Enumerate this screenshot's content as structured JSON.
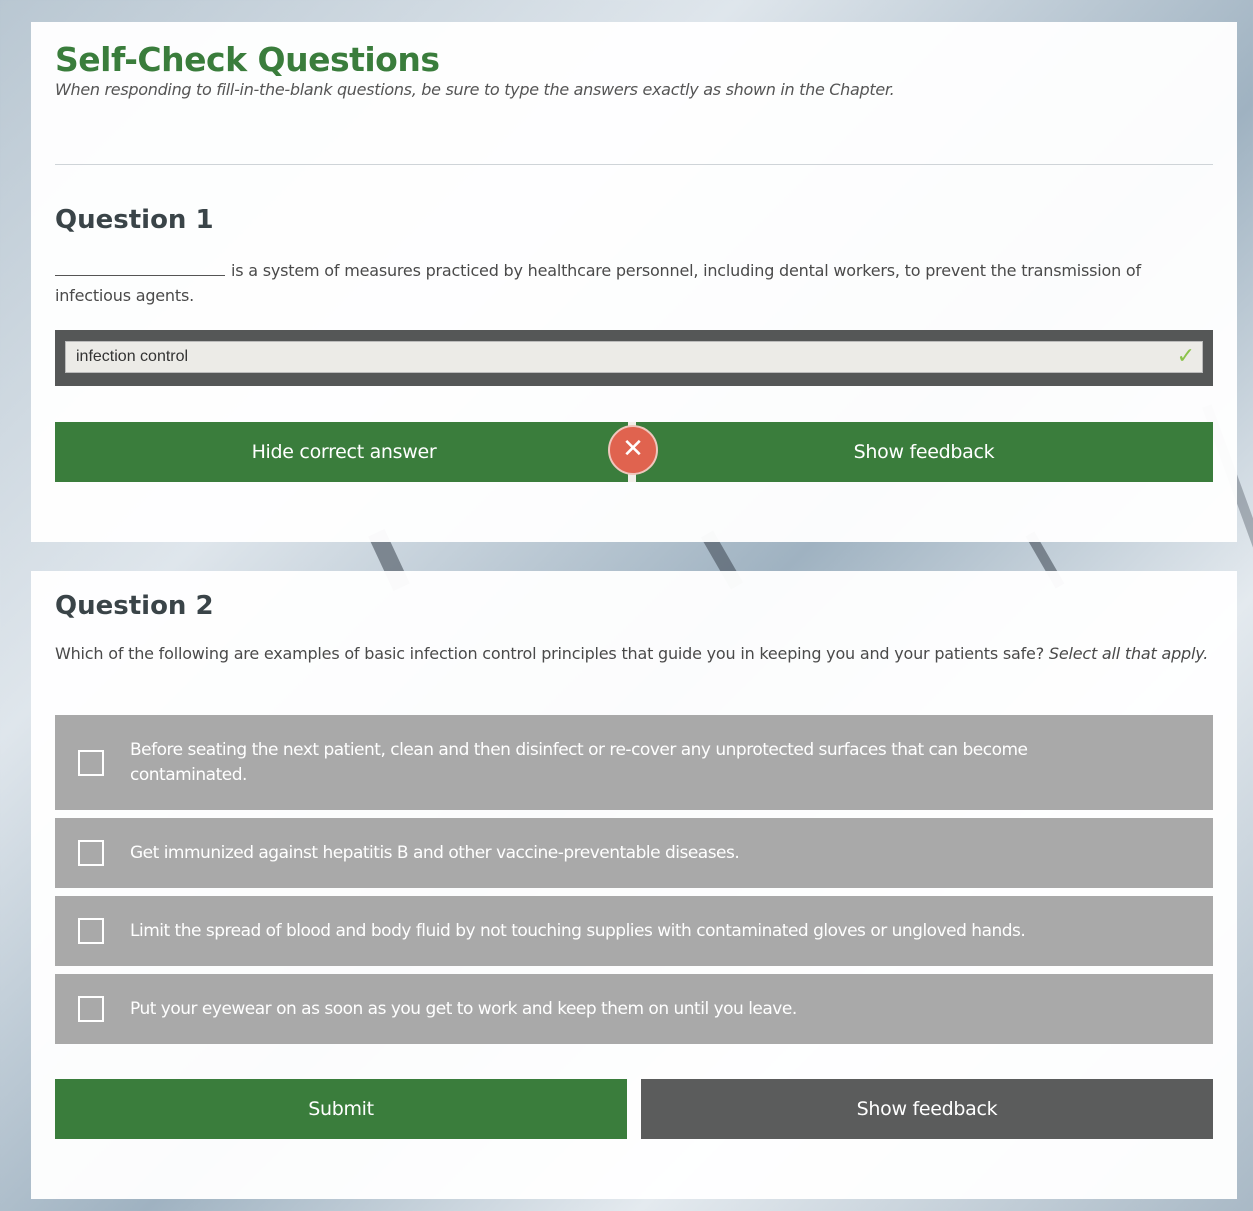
{
  "header": {
    "title": "Self-Check Questions",
    "subtitle": "When responding to fill-in-the-blank questions, be sure to type the answers exactly as shown in the Chapter."
  },
  "question1": {
    "heading": "Question 1",
    "text": "is a system of measures practiced by healthcare personnel, including dental workers, to prevent the transmission of infectious agents.",
    "answer_value": "infection control",
    "answer_status_icon": "check-icon",
    "hide_answer_label": "Hide correct answer",
    "show_feedback_label": "Show feedback",
    "retry_icon": "close-x-icon",
    "retry_glyph": "✕"
  },
  "question2": {
    "heading": "Question 2",
    "text": "Which of the following are examples of basic infection control principles that guide you in keeping you and your patients safe?",
    "text_emphasis": "Select all that apply.",
    "options": [
      {
        "label": "Before seating the next patient, clean and then disinfect or re-cover any unprotected surfaces that can become contaminated.",
        "checked": false
      },
      {
        "label": "Get immunized against hepatitis B and other vaccine-preventable diseases.",
        "checked": false
      },
      {
        "label": "Limit the spread of blood and body fluid by not touching supplies with contaminated gloves or ungloved hands.",
        "checked": false
      },
      {
        "label": "Put your eyewear on as soon as you get to work and keep them on until you leave.",
        "checked": false
      }
    ],
    "submit_label": "Submit",
    "show_feedback_label": "Show feedback"
  },
  "colors": {
    "brand_green": "#3a7d3c",
    "button_gray": "#5b5c5c",
    "option_gray": "#a9a9a9",
    "error_red": "#e0634f",
    "success_green": "#8bc34a"
  }
}
